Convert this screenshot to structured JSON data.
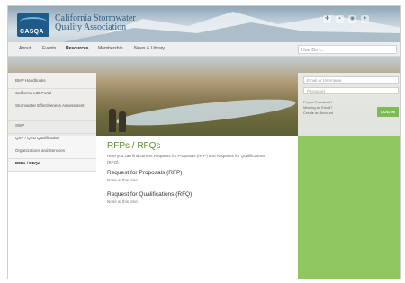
{
  "brand": {
    "logo_text": "CASQA",
    "name_line1": "California Stormwater",
    "name_line2": "Quality Association"
  },
  "social_icons": [
    "share-icon",
    "lock-icon",
    "rss-icon",
    "twitter-icon"
  ],
  "nav": {
    "items": [
      "About",
      "Events",
      "Resources",
      "Membership",
      "News & Library"
    ],
    "active": "Resources",
    "search_placeholder": "How Do I..."
  },
  "sidebar": {
    "items": [
      "BMP Handbooks",
      "California LID Portal",
      "Stormwater Effectiveness Assessment",
      "SWP",
      "QSP / QSD Qualification",
      "Organizations and Services",
      "RFPs / RFQs"
    ],
    "active": "RFPs / RFQs"
  },
  "login": {
    "username_placeholder": "Email or Username",
    "password_placeholder": "Password",
    "forgot_password": "Forgot Password?",
    "missing_email": "Missing an Email?",
    "create_account": "Create an Account",
    "login_button": "LOG IN"
  },
  "main": {
    "title": "RFPs / RFQs",
    "intro": "Here you can find current Requests for Proposals (RFP) and Requests for Qualifications (RFQ).",
    "sections": [
      {
        "heading": "Request for Proposals (RFP)",
        "body": "None at this time."
      },
      {
        "heading": "Request for Qualifications (RFQ)",
        "body": "None at this time."
      }
    ]
  },
  "colors": {
    "accent_green": "#8fc65f",
    "title_green": "#5a8f2c",
    "logo_blue": "#1f5b86"
  }
}
